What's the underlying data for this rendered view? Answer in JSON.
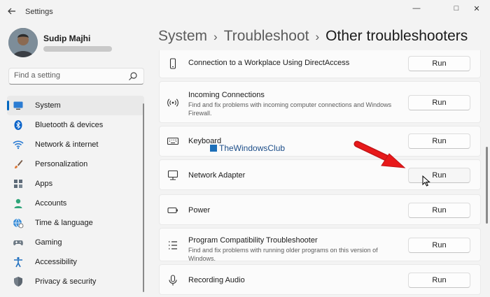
{
  "window": {
    "title": "Settings",
    "minimize": "—",
    "maximize": "□",
    "close": "✕"
  },
  "profile": {
    "name": "Sudip Majhi"
  },
  "search": {
    "placeholder": "Find a setting"
  },
  "sidebar": {
    "items": [
      {
        "label": "System",
        "icon": "monitor-icon",
        "selected": true
      },
      {
        "label": "Bluetooth & devices",
        "icon": "bluetooth-icon"
      },
      {
        "label": "Network & internet",
        "icon": "wifi-icon"
      },
      {
        "label": "Personalization",
        "icon": "brush-icon"
      },
      {
        "label": "Apps",
        "icon": "apps-icon"
      },
      {
        "label": "Accounts",
        "icon": "person-icon"
      },
      {
        "label": "Time & language",
        "icon": "globe-clock-icon"
      },
      {
        "label": "Gaming",
        "icon": "gamepad-icon"
      },
      {
        "label": "Accessibility",
        "icon": "accessibility-icon"
      },
      {
        "label": "Privacy & security",
        "icon": "shield-icon"
      }
    ]
  },
  "breadcrumb": {
    "level1": "System",
    "level2": "Troubleshoot",
    "current": "Other troubleshooters"
  },
  "troubleshooters": [
    {
      "title": "Connection to a Workplace Using DirectAccess",
      "description": "",
      "icon": "phone-icon",
      "button": "Run"
    },
    {
      "title": "Incoming Connections",
      "description": "Find and fix problems with incoming computer connections and Windows Firewall.",
      "icon": "signal-icon",
      "button": "Run"
    },
    {
      "title": "Keyboard",
      "description": "",
      "icon": "keyboard-icon",
      "button": "Run"
    },
    {
      "title": "Network Adapter",
      "description": "",
      "icon": "network-adapter-icon",
      "button": "Run",
      "hover": true
    },
    {
      "title": "Power",
      "description": "",
      "icon": "battery-icon",
      "button": "Run"
    },
    {
      "title": "Program Compatibility Troubleshooter",
      "description": "Find and fix problems with running older programs on this version of Windows.",
      "icon": "list-icon",
      "button": "Run"
    },
    {
      "title": "Recording Audio",
      "description": "",
      "icon": "microphone-icon",
      "button": "Run"
    }
  ],
  "watermark": {
    "text": "TheWindowsClub"
  },
  "colors": {
    "accent": "#0067c0",
    "arrow": "#e8191a",
    "background": "#f3f3f3",
    "card": "#fbfbfb"
  }
}
